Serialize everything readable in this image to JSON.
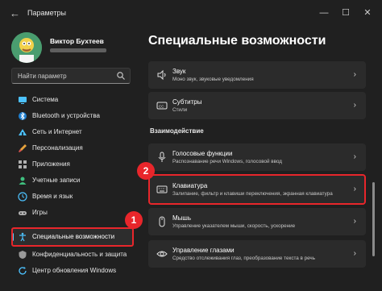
{
  "window": {
    "title": "Параметры",
    "back_icon": "back-arrow-icon",
    "minimize_glyph": "—",
    "maximize_glyph": "☐",
    "close_glyph": "✕"
  },
  "profile": {
    "name": "Виктор Бухтеев"
  },
  "search": {
    "placeholder": "Найти параметр"
  },
  "nav": {
    "items": [
      {
        "label": "Система",
        "icon": "monitor-icon",
        "color": "#4cc2ff"
      },
      {
        "label": "Bluetooth и устройства",
        "icon": "bluetooth-icon",
        "color": "#4cc2ff"
      },
      {
        "label": "Сеть и Интернет",
        "icon": "wifi-icon",
        "color": "#4cc2ff"
      },
      {
        "label": "Персонализация",
        "icon": "brush-icon",
        "color": "#e6a23c"
      },
      {
        "label": "Приложения",
        "icon": "apps-icon",
        "color": "#b0b0b0"
      },
      {
        "label": "Учетные записи",
        "icon": "person-icon",
        "color": "#3fbf7f"
      },
      {
        "label": "Время и язык",
        "icon": "globe-clock-icon",
        "color": "#4cc2ff"
      },
      {
        "label": "Игры",
        "icon": "gamepad-icon",
        "color": "#b0b0b0"
      },
      {
        "label": "Специальные возможности",
        "icon": "accessibility-icon",
        "color": "#4cc2ff",
        "active": true
      },
      {
        "label": "Конфиденциальность и защита",
        "icon": "shield-icon",
        "color": "#9a9a9a"
      },
      {
        "label": "Центр обновления Windows",
        "icon": "update-icon",
        "color": "#4cc2ff"
      }
    ]
  },
  "main": {
    "title": "Специальные возможности",
    "section_title": "Взаимодействие",
    "cards": [
      {
        "title": "Звук",
        "subtitle": "Моно звук, звуковые уведомления",
        "icon": "speaker-icon"
      },
      {
        "title": "Субтитры",
        "subtitle": "Стили",
        "icon": "captions-icon"
      },
      {
        "title": "Голосовые функции",
        "subtitle": "Распознавание речи Windows, голосовой ввод",
        "icon": "microphone-icon"
      },
      {
        "title": "Клавиатура",
        "subtitle": "Залипание, фильтр и клавиши переключения, экранная клавиатура",
        "icon": "keyboard-icon"
      },
      {
        "title": "Мышь",
        "subtitle": "Управление указателем мыши, скорость, ускорение",
        "icon": "mouse-icon"
      },
      {
        "title": "Управление глазами",
        "subtitle": "Средство отслеживания глаз, преобразование текста в речь",
        "icon": "eye-icon"
      }
    ]
  },
  "annotations": {
    "badge1": "1",
    "badge2": "2",
    "color": "#e8262b"
  },
  "accent": "#60cdff"
}
